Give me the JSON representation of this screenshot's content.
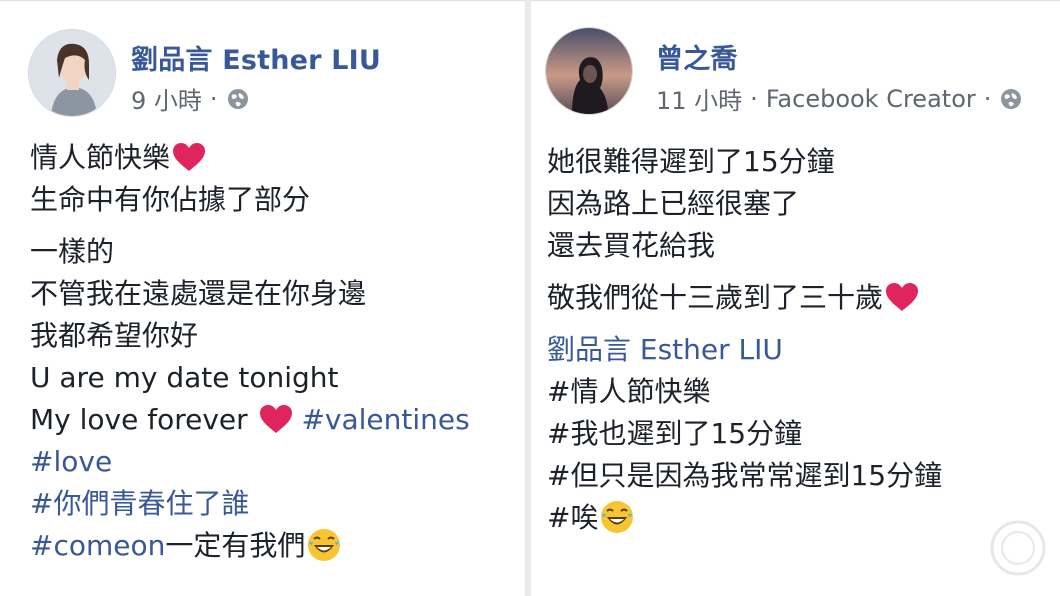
{
  "posts": [
    {
      "author": "劉品言 Esther LIU",
      "time": "9 小時",
      "sep": "·",
      "privacy_icon": "globe-icon",
      "avatar_icon": "profile-photo-woman",
      "lines": [
        {
          "text": "情人節快樂",
          "emoji": "heart"
        },
        {
          "text": "生命中有你佔據了部分"
        },
        {
          "gap": true
        },
        {
          "text": "一樣的"
        },
        {
          "text": "不管我在遠處還是在你身邊"
        },
        {
          "text": "我都希望你好"
        },
        {
          "text": "U are my date tonight"
        },
        {
          "text": "My love forever ",
          "emoji": "heart",
          "tag_after": " #valentines"
        },
        {
          "tag": "#love"
        },
        {
          "tag": "#你們青春住了誰"
        },
        {
          "tag": "#comeon",
          "text_after": "一定有我們",
          "emoji_after": "laugh"
        }
      ]
    },
    {
      "author": "曾之喬",
      "time": "11 小時",
      "sep": "·",
      "creator": "Facebook Creator",
      "privacy_icon": "globe-icon",
      "avatar_icon": "profile-photo-woman-dusk",
      "lines": [
        {
          "text": "她很難得遲到了15分鐘"
        },
        {
          "text": "因為路上已經很塞了"
        },
        {
          "text": "還去買花給我"
        },
        {
          "gap": true
        },
        {
          "text": "敬我們從十三歲到了三十歲",
          "emoji": "heart"
        },
        {
          "gap": true
        },
        {
          "mention": "劉品言 Esther LIU"
        },
        {
          "tag_prefix": "#",
          "text": "情人節快樂"
        },
        {
          "tag_prefix": "#",
          "text": "我也遲到了15分鐘"
        },
        {
          "tag_prefix": "#",
          "text": "但只是因為我常常遲到15分鐘"
        },
        {
          "tag_prefix": "#",
          "text": "唉",
          "emoji": "laugh"
        }
      ]
    }
  ],
  "colors": {
    "link": "#385898",
    "text": "#1d2129",
    "meta": "#606770",
    "heart": "#e0245e",
    "laugh": "#f7c531"
  }
}
